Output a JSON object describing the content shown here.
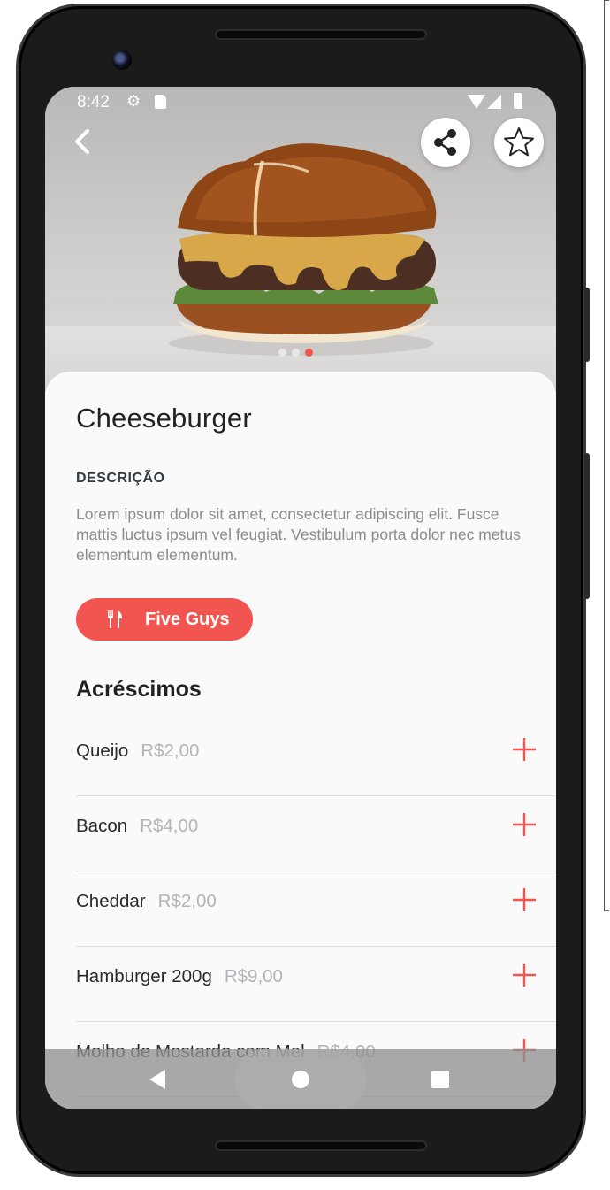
{
  "status_bar": {
    "time": "8:42"
  },
  "product": {
    "title": "Cheeseburger",
    "description_heading": "DESCRIÇÃO",
    "description": "Lorem ipsum dolor sit amet, consectetur adipiscing elit. Fusce mattis luctus ipsum vel feugiat. Vestibulum porta dolor nec metus elementum elementum.",
    "restaurant": "Five Guys",
    "carousel": {
      "count": 3,
      "active_index": 2
    }
  },
  "extras": {
    "heading": "Acréscimos",
    "items": [
      {
        "name": "Queijo",
        "price": "R$2,00"
      },
      {
        "name": "Bacon",
        "price": "R$4,00"
      },
      {
        "name": "Cheddar",
        "price": "R$2,00"
      },
      {
        "name": "Hamburger 200g",
        "price": "R$9,00"
      },
      {
        "name": "Molho de Mostarda com Mel",
        "price": "R$4,00"
      }
    ]
  },
  "icons": {
    "back": "back-arrow-icon",
    "share": "share-icon",
    "favorite": "star-icon",
    "restaurant": "fork-knife-icon",
    "add": "plus-icon"
  },
  "colors": {
    "accent": "#f2554f",
    "title": "#222222",
    "muted": "#8c8c8c",
    "price": "#b4b4b8"
  }
}
